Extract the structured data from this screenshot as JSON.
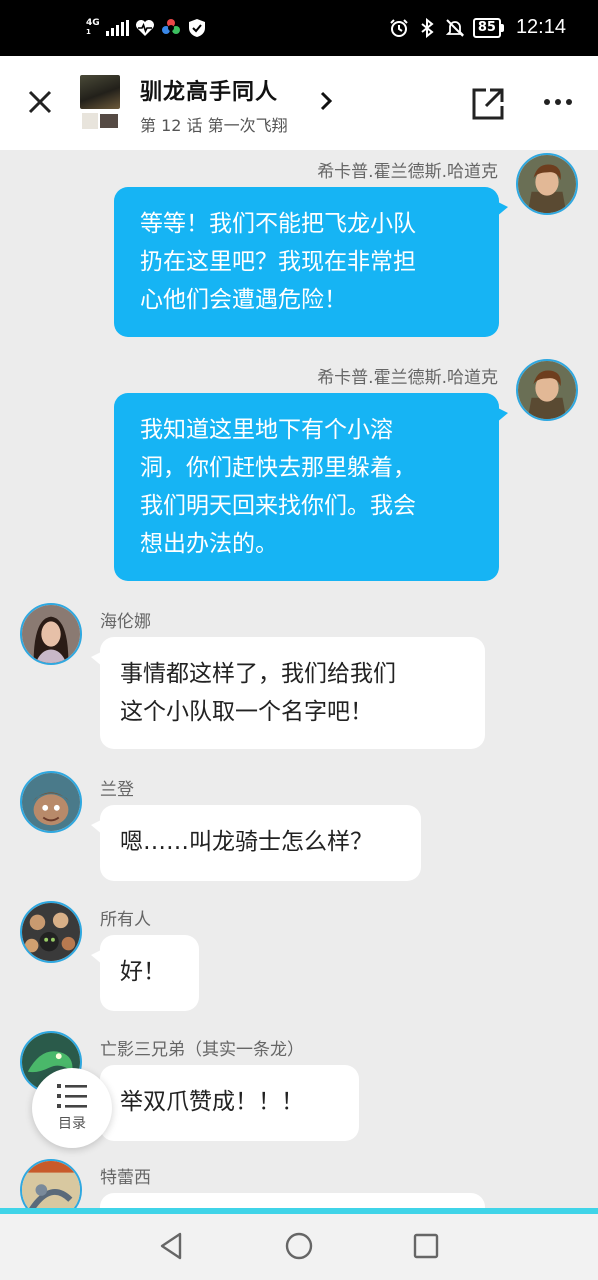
{
  "status_bar": {
    "network": "4G",
    "network_sub": "1",
    "battery": "85",
    "time": "12:14"
  },
  "header": {
    "title": "驯龙高手同人",
    "subtitle": "第 12 话 第一次飞翔"
  },
  "messages": [
    {
      "sender": "希卡普.霍兰德斯.哈道克",
      "side": "right",
      "lines": [
        "等等！我们不能把飞龙小队",
        "扔在这里吧？我现在非常担",
        "心他们会遭遇危险！"
      ]
    },
    {
      "sender": "希卡普.霍兰德斯.哈道克",
      "side": "right",
      "lines": [
        "我知道这里地下有个小溶",
        "洞，你们赶快去那里躲着，",
        "我们明天回来找你们。我会",
        "想出办法的。"
      ]
    },
    {
      "sender": "海伦娜",
      "side": "left",
      "lines": [
        "事情都这样了，我们给我们",
        "这个小队取一个名字吧！"
      ]
    },
    {
      "sender": "兰登",
      "side": "left",
      "lines": [
        "嗯……叫龙骑士怎么样？"
      ]
    },
    {
      "sender": "所有人",
      "side": "left",
      "lines": [
        "好！"
      ]
    },
    {
      "sender": "亡影三兄弟（其实一条龙）",
      "side": "left",
      "lines": [
        "举双爪赞成！！！"
      ]
    },
    {
      "sender": "特蕾西",
      "side": "left",
      "lines": [
        ""
      ]
    }
  ],
  "toc": {
    "label": "目录"
  },
  "colors": {
    "accent": "#16b4f4",
    "background": "#ececec",
    "nav_line": "#40d4e8"
  }
}
